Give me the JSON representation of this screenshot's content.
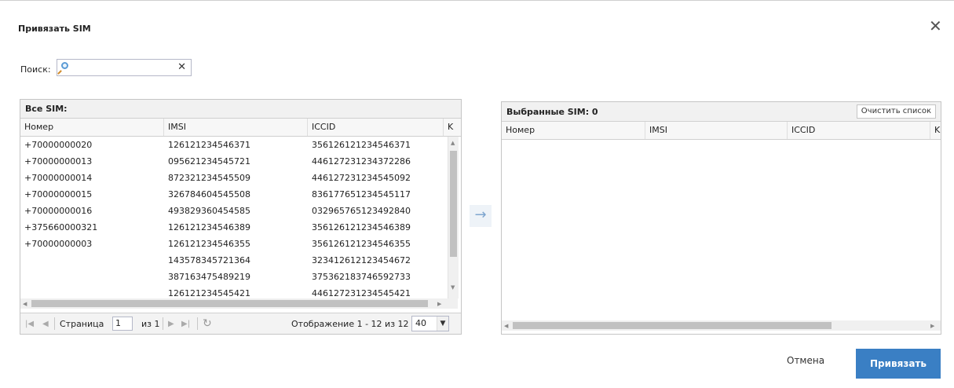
{
  "dialog": {
    "title": "Привязать SIM",
    "close_glyph": "✕",
    "search_label": "Поиск:",
    "search_value": "",
    "search_clear": "✕",
    "move_glyph": "→",
    "cancel_label": "Отмена",
    "bind_label": "Привязать"
  },
  "all_sims": {
    "title": "Все SIM:",
    "columns": [
      "Номер",
      "IMSI",
      "ICCID",
      "K"
    ],
    "rows": [
      [
        "+70000000020",
        "126121234546371",
        "356126121234546371"
      ],
      [
        "+70000000013",
        "095621234545721",
        "446127231234372286"
      ],
      [
        "+70000000014",
        "872321234545509",
        "446127231234545092"
      ],
      [
        "+70000000015",
        "326784604545508",
        "836177651234545117"
      ],
      [
        "+70000000016",
        "493829360454585",
        "032965765123492840"
      ],
      [
        "+375660000321",
        "126121234546389",
        "356126121234546389"
      ],
      [
        "+70000000003",
        "126121234546355",
        "356126121234546355"
      ],
      [
        "",
        "143578345721364",
        "323412612123454672"
      ],
      [
        "",
        "387163475489219",
        "375362183746592733"
      ],
      [
        "",
        "126121234545421",
        "446127231234545421"
      ]
    ],
    "pager": {
      "page_label": "Страница",
      "page_value": "1",
      "of_label": "из 1",
      "display_text": "Отображение 1 - 12 из 12",
      "page_size": "40"
    }
  },
  "selected_sims": {
    "title": "Выбранные SIM: 0",
    "clear_label": "Очистить список",
    "columns": [
      "Номер",
      "IMSI",
      "ICCID",
      "K"
    ]
  },
  "icons": [
    "search-icon",
    "close-icon",
    "clear-search-icon",
    "move-right-icon",
    "first-page-icon",
    "prev-page-icon",
    "next-page-icon",
    "last-page-icon",
    "refresh-icon"
  ],
  "colors": {
    "primary_button": "#3a7fc4",
    "accent_icon": "#5b9bd5"
  }
}
